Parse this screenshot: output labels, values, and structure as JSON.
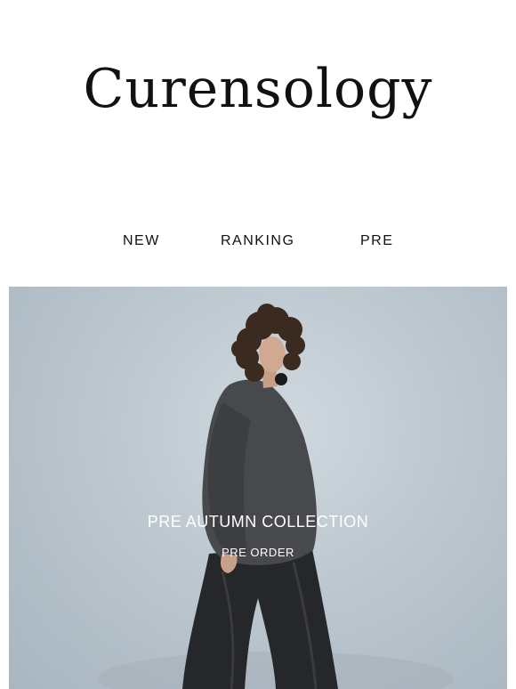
{
  "brand": {
    "logo_text": "Curensology"
  },
  "nav": {
    "items": [
      "NEW",
      "RANKING",
      "PRE"
    ]
  },
  "hero": {
    "title": "PRE AUTUMN COLLECTION",
    "subtitle": "PRE ORDER"
  }
}
